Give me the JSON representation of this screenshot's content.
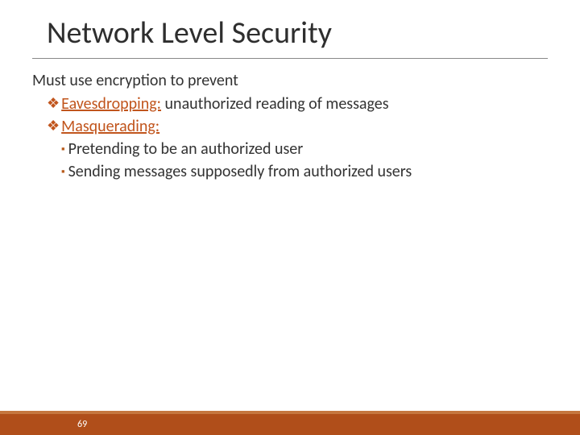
{
  "title": "Network Level Security",
  "intro": "Must use encryption to prevent",
  "items": [
    {
      "term": "Eavesdropping:",
      "desc": " unauthorized reading of messages"
    },
    {
      "term": "Masquerading:",
      "desc": ""
    }
  ],
  "subitems": [
    "Pretending to be an authorized user",
    "Sending messages supposedly from authorized users"
  ],
  "pageNumber": "69",
  "glyphs": {
    "diamond": "❖",
    "square": "▪"
  }
}
